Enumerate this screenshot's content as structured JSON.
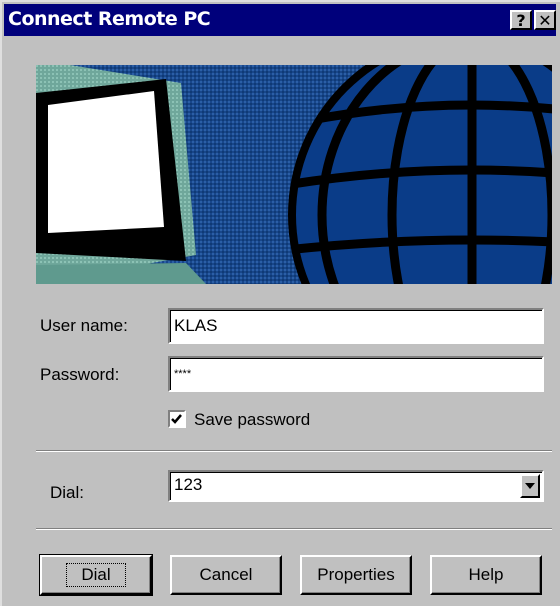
{
  "window": {
    "title": "Connect Remote PC",
    "help_label": "?",
    "close_label": "✕"
  },
  "form": {
    "username_label": "User name:",
    "username_value": "KLAS",
    "password_label": "Password:",
    "password_value": "****",
    "save_password_label": "Save password",
    "save_password_checked": true,
    "dial_label": "Dial:",
    "dial_value": "123"
  },
  "buttons": {
    "dial": "Dial",
    "cancel": "Cancel",
    "properties": "Properties",
    "help": "Help"
  },
  "icons": {
    "banner": "computer-globe-illustration",
    "dropdown": "chevron-down-icon",
    "check": "checkmark-icon"
  },
  "colors": {
    "titlebar": "#00007b",
    "face": "#c0c0c0",
    "banner_bg": "#1a4c8a",
    "globe": "#0a3c88",
    "monitor_teal": "#7fb3a8"
  }
}
